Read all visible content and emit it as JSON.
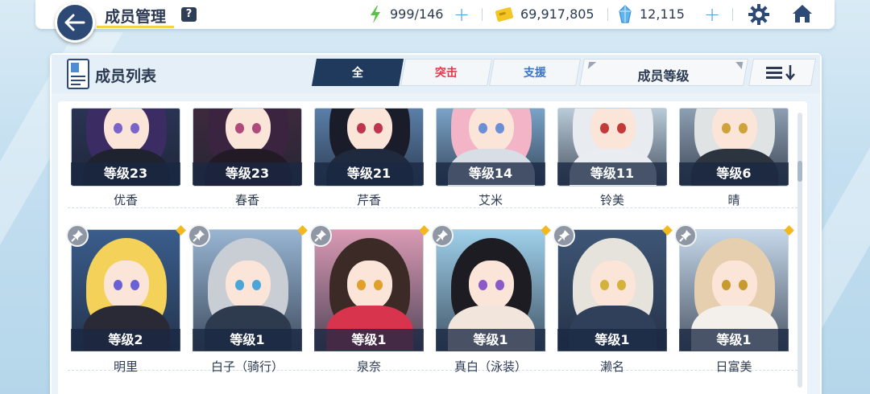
{
  "header": {
    "title": "成员管理",
    "help_label": "?",
    "stamina": "999/146",
    "credits": "69,917,805",
    "gems": "12,115",
    "plus": "+"
  },
  "panel": {
    "title": "成员列表",
    "tabs": [
      {
        "label": "全",
        "active": true
      },
      {
        "label": "突击",
        "active": false
      },
      {
        "label": "支援",
        "active": false
      }
    ],
    "sort_label": "成员等级"
  },
  "colors": {
    "accent_dark": "#203a5e",
    "striker_red": "#e2374b",
    "special_blue": "#3a74c9",
    "new_marker": "#f2b81d"
  },
  "students_row1": [
    {
      "level": "等级23",
      "name": "优香"
    },
    {
      "level": "等级23",
      "name": "春香"
    },
    {
      "level": "等级21",
      "name": "芹香"
    },
    {
      "level": "等级14",
      "name": "艾米"
    },
    {
      "level": "等级11",
      "name": "铃美"
    },
    {
      "level": "等级6",
      "name": "晴"
    }
  ],
  "students_row2": [
    {
      "level": "等级2",
      "name": "明里"
    },
    {
      "level": "等级1",
      "name": "白子（骑行）"
    },
    {
      "level": "等级1",
      "name": "泉奈"
    },
    {
      "level": "等级1",
      "name": "真白（泳装）"
    },
    {
      "level": "等级1",
      "name": "濑名"
    },
    {
      "level": "等级1",
      "name": "日富美"
    }
  ]
}
